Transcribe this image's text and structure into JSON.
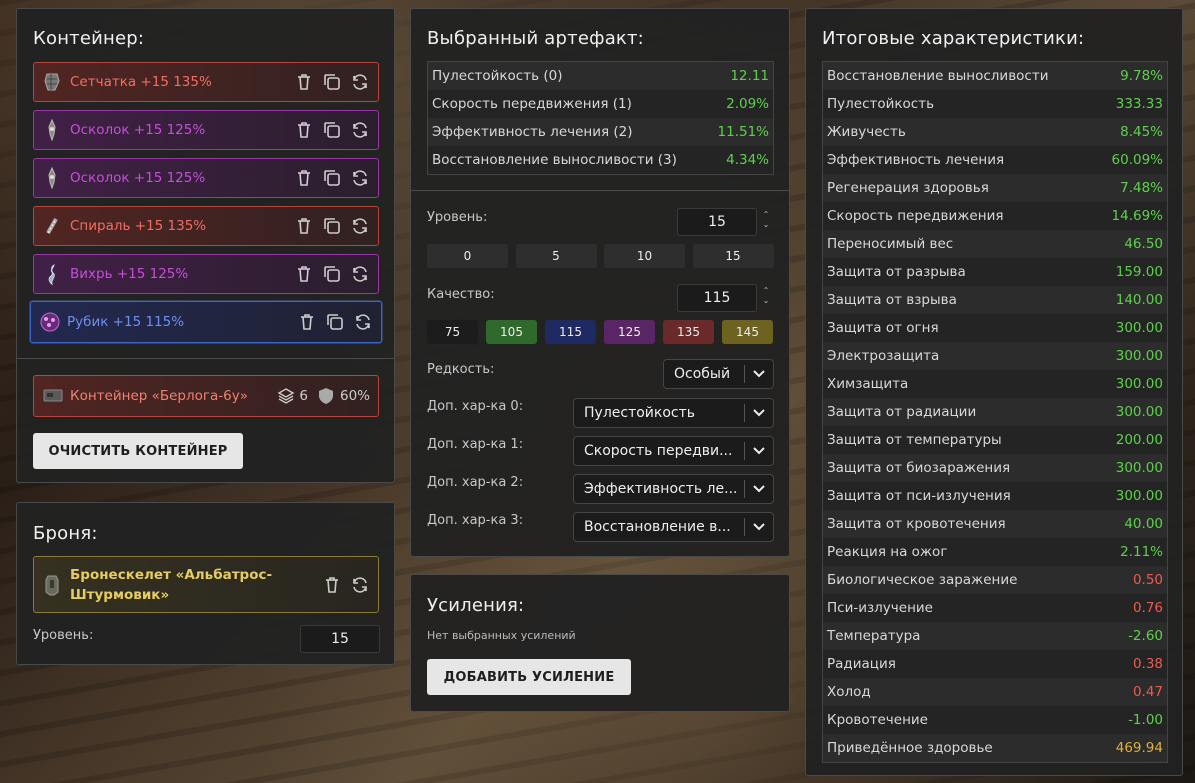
{
  "container": {
    "title": "Контейнер:",
    "items": [
      {
        "label": "Сетчатка +15 135%",
        "color": "red",
        "icon": "mesh-artifact-icon"
      },
      {
        "label": "Осколок +15 125%",
        "color": "purple",
        "icon": "shard-artifact-icon"
      },
      {
        "label": "Осколок +15 125%",
        "color": "purple",
        "icon": "shard-artifact-icon"
      },
      {
        "label": "Спираль +15 135%",
        "color": "red",
        "icon": "spiral-artifact-icon"
      },
      {
        "label": "Вихрь +15 125%",
        "color": "purple",
        "icon": "vortex-artifact-icon"
      },
      {
        "label": "Рубик +15 115%",
        "color": "blue",
        "icon": "rubik-artifact-icon"
      }
    ],
    "container_item": {
      "label": "Контейнер «Берлога-6у»",
      "slots": "6",
      "protection": "60%"
    },
    "clear_button": "ОЧИСТИТЬ КОНТЕЙНЕР"
  },
  "armor": {
    "title": "Броня:",
    "item_line1": "Бронескелет «Альбатрос-",
    "item_line2": "Штурмовик»",
    "level_label": "Уровень:",
    "level_value": "15"
  },
  "artifact": {
    "title": "Выбранный артефакт:",
    "stats": [
      {
        "name": "Пулестойкость (0)",
        "value": "12.11"
      },
      {
        "name": "Скорость передвижения (1)",
        "value": "2.09%"
      },
      {
        "name": "Эффективность лечения (2)",
        "value": "11.51%"
      },
      {
        "name": "Восстановление выносливости (3)",
        "value": "4.34%"
      }
    ],
    "level_label": "Уровень:",
    "level_value": "15",
    "level_presets": [
      "0",
      "5",
      "10",
      "15"
    ],
    "quality_label": "Качество:",
    "quality_value": "115",
    "quality_presets": [
      {
        "label": "75",
        "color": "#1c1c1c"
      },
      {
        "label": "105",
        "color": "#2f6a2c"
      },
      {
        "label": "115",
        "color": "#1f2a62"
      },
      {
        "label": "125",
        "color": "#5a2564"
      },
      {
        "label": "135",
        "color": "#6a2a2a"
      },
      {
        "label": "145",
        "color": "#6e6220"
      }
    ],
    "rarity_label": "Редкость:",
    "rarity_value": "Особый",
    "extra": [
      {
        "label": "Доп. хар-ка 0:",
        "value": "Пулестойкость"
      },
      {
        "label": "Доп. хар-ка 1:",
        "value": "Скорость передви..."
      },
      {
        "label": "Доп. хар-ка 2:",
        "value": "Эффективность ле..."
      },
      {
        "label": "Доп. хар-ка 3:",
        "value": "Восстановление в..."
      }
    ]
  },
  "boosts": {
    "title": "Усиления:",
    "empty_text": "Нет выбранных усилений",
    "add_button": "ДОБАВИТЬ УСИЛЕНИЕ"
  },
  "totals": {
    "title": "Итоговые характеристики:",
    "rows": [
      {
        "name": "Восстановление выносливости",
        "value": "9.78%",
        "tone": "green"
      },
      {
        "name": "Пулестойкость",
        "value": "333.33",
        "tone": "green"
      },
      {
        "name": "Живучесть",
        "value": "8.45%",
        "tone": "green"
      },
      {
        "name": "Эффективность лечения",
        "value": "60.09%",
        "tone": "green"
      },
      {
        "name": "Регенерация здоровья",
        "value": "7.48%",
        "tone": "green"
      },
      {
        "name": "Скорость передвижения",
        "value": "14.69%",
        "tone": "green"
      },
      {
        "name": "Переносимый вес",
        "value": "46.50",
        "tone": "green"
      },
      {
        "name": "Защита от разрыва",
        "value": "159.00",
        "tone": "green"
      },
      {
        "name": "Защита от взрыва",
        "value": "140.00",
        "tone": "green"
      },
      {
        "name": "Защита от огня",
        "value": "300.00",
        "tone": "green"
      },
      {
        "name": "Электрозащита",
        "value": "300.00",
        "tone": "green"
      },
      {
        "name": "Химзащита",
        "value": "300.00",
        "tone": "green"
      },
      {
        "name": "Защита от радиации",
        "value": "300.00",
        "tone": "green"
      },
      {
        "name": "Защита от температуры",
        "value": "200.00",
        "tone": "green"
      },
      {
        "name": "Защита от биозаражения",
        "value": "300.00",
        "tone": "green"
      },
      {
        "name": "Защита от пси-излучения",
        "value": "300.00",
        "tone": "green"
      },
      {
        "name": "Защита от кровотечения",
        "value": "40.00",
        "tone": "green"
      },
      {
        "name": "Реакция на ожог",
        "value": "2.11%",
        "tone": "green"
      },
      {
        "name": "Биологическое заражение",
        "value": "0.50",
        "tone": "red"
      },
      {
        "name": "Пси-излучение",
        "value": "0.76",
        "tone": "red"
      },
      {
        "name": "Температура",
        "value": "-2.60",
        "tone": "green"
      },
      {
        "name": "Радиация",
        "value": "0.38",
        "tone": "red"
      },
      {
        "name": "Холод",
        "value": "0.47",
        "tone": "red"
      },
      {
        "name": "Кровотечение",
        "value": "-1.00",
        "tone": "green"
      },
      {
        "name": "Приведённое здоровье",
        "value": "469.94",
        "tone": "gold"
      }
    ]
  }
}
